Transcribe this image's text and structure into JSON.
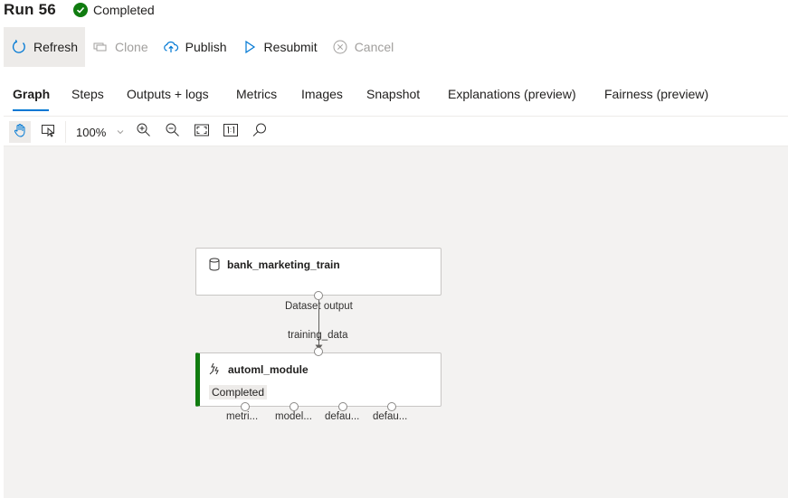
{
  "header": {
    "title": "Run 56",
    "status": "Completed"
  },
  "commands": {
    "refresh": "Refresh",
    "clone": "Clone",
    "publish": "Publish",
    "resubmit": "Resubmit",
    "cancel": "Cancel"
  },
  "tabs": [
    "Graph",
    "Steps",
    "Outputs + logs",
    "Metrics",
    "Images",
    "Snapshot",
    "Explanations (preview)",
    "Fairness (preview)"
  ],
  "toolbar": {
    "zoom": "100%"
  },
  "graph": {
    "dataset_node": {
      "title": "bank_marketing_train",
      "output_label": "Dataset output"
    },
    "edge_label": "training_data",
    "module_node": {
      "title": "automl_module",
      "status": "Completed",
      "outputs": [
        "metri...",
        "model...",
        "defau...",
        "defau..."
      ]
    }
  },
  "colors": {
    "accent": "#0078d4",
    "success": "#107c10",
    "canvas": "#f3f2f1"
  }
}
